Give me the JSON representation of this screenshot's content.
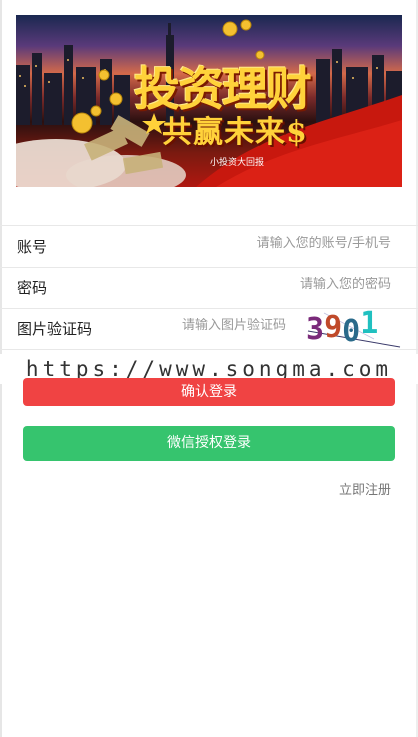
{
  "banner": {
    "title": "投资理财",
    "subtitle": "共赢未来$",
    "caption": "小投资大回报"
  },
  "form": {
    "account": {
      "label": "账号",
      "placeholder": "请输入您的账号/手机号"
    },
    "password": {
      "label": "密码",
      "placeholder": "请输入您的密码"
    },
    "captcha": {
      "label": "图片验证码",
      "placeholder": "请输入图片验证码",
      "image_text": "3901"
    }
  },
  "watermark": "https://www.songma.com",
  "buttons": {
    "login": "确认登录",
    "wechat_login": "微信授权登录"
  },
  "register_link": "立即注册",
  "colors": {
    "login_button": "#f04343",
    "wechat_button": "#36c46e",
    "banner_text": "#ffd23a"
  }
}
